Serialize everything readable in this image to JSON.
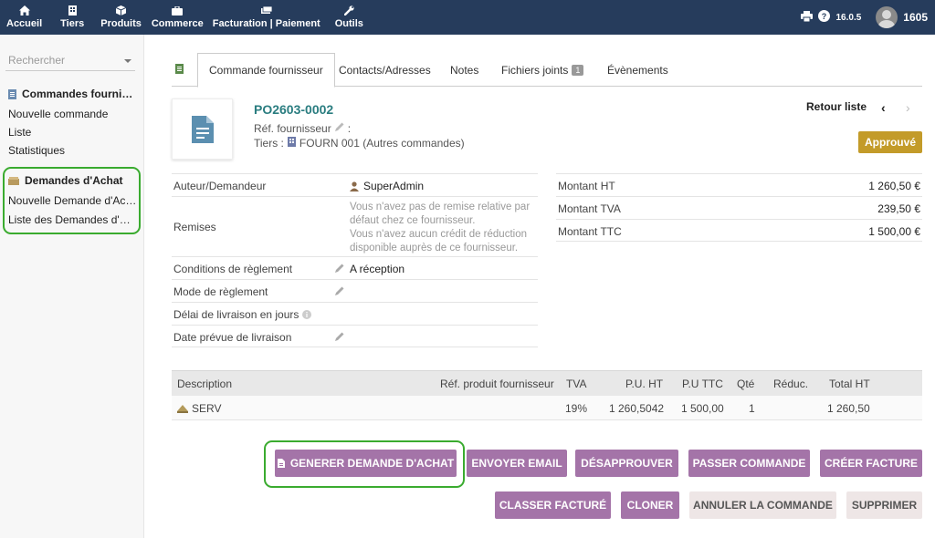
{
  "topnav": [
    {
      "label": "Accueil",
      "icon": "home-icon"
    },
    {
      "label": "Tiers",
      "icon": "building-icon"
    },
    {
      "label": "Produits",
      "icon": "cube-icon"
    },
    {
      "label": "Commerce",
      "icon": "briefcase-icon"
    },
    {
      "label": "Facturation | Paiement",
      "icon": "money-icon"
    },
    {
      "label": "Outils",
      "icon": "wrench-icon"
    }
  ],
  "topright": {
    "version": "16.0.5",
    "username": "1605"
  },
  "leftmenu": {
    "search_placeholder": "Rechercher",
    "section1_title": "Commandes fournisseurs",
    "section1_items": [
      "Nouvelle commande",
      "Liste",
      "Statistiques"
    ],
    "section2_title": "Demandes d'Achat",
    "section2_items": [
      "Nouvelle Demande d'Achat",
      "Liste des Demandes d'Achat"
    ]
  },
  "tabs": [
    {
      "label": "Commande fournisseur",
      "active": true
    },
    {
      "label": "Contacts/Adresses"
    },
    {
      "label": "Notes"
    },
    {
      "label": "Fichiers joints",
      "badge": "1"
    },
    {
      "label": "Évènements"
    }
  ],
  "header": {
    "ref": "PO2603-0002",
    "ref_fournisseur_label": "Réf. fournisseur",
    "ref_fournisseur_suffix": ":",
    "tiers_label": "Tiers :",
    "tiers_value": "FOURN 001 (Autres commandes)",
    "retour": "Retour liste",
    "status": "Approuvé"
  },
  "fields": {
    "auteur_label": "Auteur/Demandeur",
    "auteur_value": "SuperAdmin",
    "remises_label": "Remises",
    "remises_text1": "Vous n'avez pas de remise relative par défaut chez ce fournisseur.",
    "remises_text2": "Vous n'avez aucun crédit de réduction disponible auprès de ce fournisseur.",
    "conditions_label": "Conditions de règlement",
    "conditions_value": "A réception",
    "mode_label": "Mode de règlement",
    "delai_label": "Délai de livraison en jours",
    "date_label": "Date prévue de livraison"
  },
  "amounts": [
    {
      "label": "Montant HT",
      "value": "1 260,50 €"
    },
    {
      "label": "Montant TVA",
      "value": "239,50 €"
    },
    {
      "label": "Montant TTC",
      "value": "1 500,00 €"
    }
  ],
  "lines": {
    "headers": {
      "description": "Description",
      "ref": "Réf. produit fournisseur",
      "tva": "TVA",
      "puht": "P.U. HT",
      "puttc": "P.U TTC",
      "qte": "Qté",
      "reduc": "Réduc.",
      "total": "Total HT"
    },
    "rows": [
      {
        "description": "SERV",
        "ref": "",
        "tva": "19%",
        "puht": "1 260,5042",
        "puttc": "1 500,00",
        "qte": "1",
        "reduc": "",
        "total": "1 260,50"
      }
    ]
  },
  "actions": {
    "generer": "Generer demande d'achat",
    "email": "Envoyer email",
    "desapprouver": "Désapprouver",
    "passer": "Passer commande",
    "creer_facture": "Créer facture",
    "classer": "Classer facturé",
    "cloner": "Cloner",
    "annuler": "Annuler la commande",
    "supprimer": "Supprimer"
  },
  "colors": {
    "topbar": "#263c5c",
    "accent": "#a474a8",
    "status": "#c39b29",
    "ref": "#2a7d80",
    "highlight": "#3aab2f"
  }
}
